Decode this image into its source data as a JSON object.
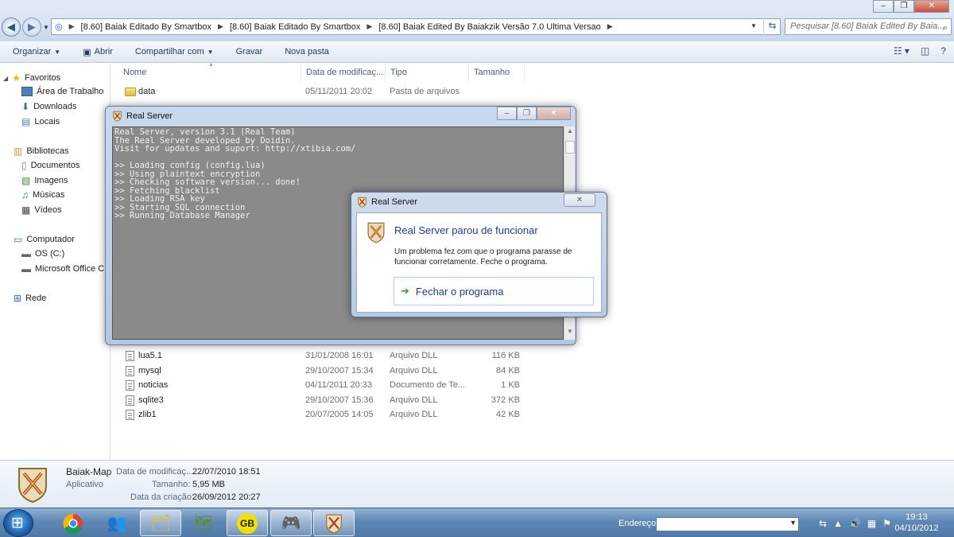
{
  "window": {
    "min_glyph": "–",
    "max_glyph": "❐",
    "close_glyph": "✕"
  },
  "address": {
    "crumbs": [
      "[8.60] Baiak Editado By Smartbox",
      "[8.60] Baiak Editado By Smartbox",
      "[8.60] Baiak Edited By Baiakzik Versão 7.0 Ultima Versao"
    ],
    "search_placeholder": "Pesquisar [8.60] Baiak Edited By Baia..."
  },
  "toolbar": {
    "organize": "Organizar",
    "open": "Abrir",
    "share": "Compartilhar com",
    "burn": "Gravar",
    "new_folder": "Nova pasta"
  },
  "nav": {
    "favorites": "Favoritos",
    "desktop": "Área de Trabalho",
    "downloads": "Downloads",
    "places": "Locais",
    "libraries": "Bibliotecas",
    "documents": "Documentos",
    "images": "Imagens",
    "music": "Músicas",
    "videos": "Vídeos",
    "computer": "Computador",
    "os_c": "OS (C:)",
    "office": "Microsoft Office Cl",
    "network": "Rede"
  },
  "columns": {
    "name": "Nome",
    "date": "Data de modificaç...",
    "type": "Tipo",
    "size": "Tamanho"
  },
  "files": {
    "data": {
      "name": "data",
      "date": "05/11/2011 20:02",
      "type": "Pasta de arquivos",
      "size": ""
    },
    "lua": {
      "name": "lua5.1",
      "date": "31/01/2008 16:01",
      "type": "Arquivo DLL",
      "size": "116 KB"
    },
    "mysql": {
      "name": "mysql",
      "date": "29/10/2007 15:34",
      "type": "Arquivo DLL",
      "size": "84 KB"
    },
    "noticias": {
      "name": "noticias",
      "date": "04/11/2011 20:33",
      "type": "Documento de Te...",
      "size": "1 KB"
    },
    "sqlite": {
      "name": "sqlite3",
      "date": "29/10/2007 15:36",
      "type": "Arquivo DLL",
      "size": "372 KB"
    },
    "zlib": {
      "name": "zlib1",
      "date": "20/07/2005 14:05",
      "type": "Arquivo DLL",
      "size": "42 KB"
    }
  },
  "details": {
    "name": "Baiak-Map",
    "kind": "Aplicativo",
    "modified_label": "Data de modificaç...",
    "modified_value": "22/07/2010 18:51",
    "size_label": "Tamanho:",
    "size_value": "5,95 MB",
    "created_label": "Data da criação:",
    "created_value": "26/09/2012 20:27"
  },
  "console": {
    "title": "Real Server",
    "text": "Real Server, version 3.1 (Real Team)\nThe Real Server developed by Doidin.\nVisit for updates and suport: http://xtibia.com/\n\n>> Loading config (config.lua)\n>> Using plaintext encryption\n>> Checking software version... done!\n>> Fetching blacklist\n>> Loading RSA key\n>> Starting SQL connection\n>> Running Database Manager"
  },
  "dialog": {
    "title": "Real Server",
    "heading": "Real Server parou de funcionar",
    "message": "Um problema fez com que o programa parasse de funcionar corretamente. Feche o programa.",
    "action": "Fechar o programa"
  },
  "taskbar": {
    "address_label": "Endereço",
    "time": "19:13",
    "date": "04/10/2012"
  },
  "colors": {
    "accent": "#1e3c8c",
    "action_green": "#2ea12a",
    "console_bg": "#8a8a8a"
  }
}
